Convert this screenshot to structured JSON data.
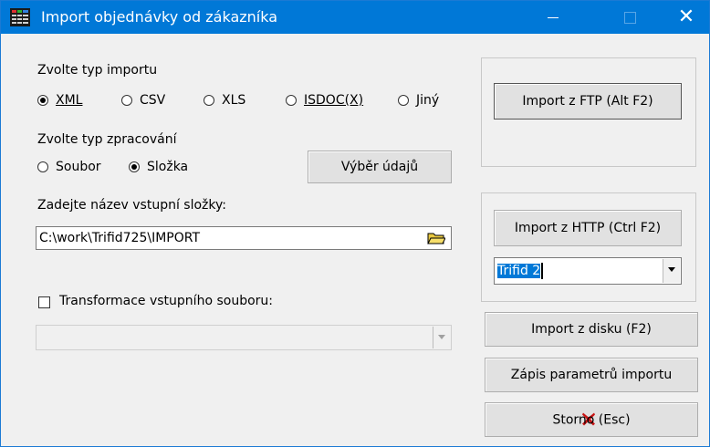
{
  "window": {
    "title": "Import objednávky od zákazníka",
    "close_glyph": "✕",
    "icon": "app-grid-icon"
  },
  "import_type": {
    "label": "Zvolte typ importu",
    "options": [
      {
        "label": "XML",
        "selected": true
      },
      {
        "label": "CSV",
        "selected": false
      },
      {
        "label": "XLS",
        "selected": false
      },
      {
        "label": "ISDOC(X)",
        "selected": false
      },
      {
        "label": "Jiný",
        "selected": false
      }
    ]
  },
  "processing_type": {
    "label": "Zvolte typ zpracování",
    "options": [
      {
        "label": "Soubor",
        "selected": false
      },
      {
        "label": "Složka",
        "selected": true
      }
    ]
  },
  "buttons": {
    "data_selection": "Výběr údajů",
    "import_ftp": "Import z FTP (Alt F2)",
    "import_http": "Import z HTTP (Ctrl F2)",
    "import_disk": "Import z disku (F2)",
    "save_params": "Zápis parametrů importu",
    "cancel": "Storno (Esc)"
  },
  "folder": {
    "label": "Zadejte název vstupní složky:",
    "value": "C:\\work\\Trifid725\\IMPORT",
    "browse_icon": "folder-icon"
  },
  "transform": {
    "label": "Transformace vstupního souboru:",
    "checked": false,
    "select_value": ""
  },
  "http_profile": {
    "value": "Trifid 2"
  },
  "colors": {
    "titlebar": "#0078d7",
    "window_bg": "#f0f0f0",
    "cancel_icon": "#c81414",
    "selection": "#0078d7"
  }
}
